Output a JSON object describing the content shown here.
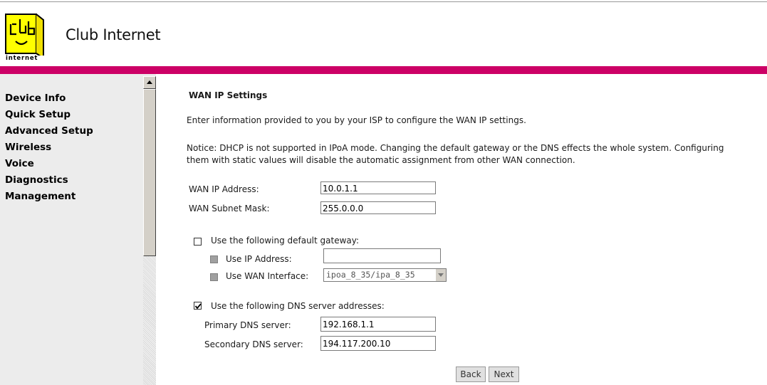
{
  "brand": {
    "title": "Club Internet",
    "logo_text": "internet",
    "logo_color": "#ffff00",
    "bar_color": "#cc0066"
  },
  "sidebar": {
    "items": [
      {
        "label": "Device Info"
      },
      {
        "label": "Quick Setup"
      },
      {
        "label": "Advanced Setup"
      },
      {
        "label": "Wireless"
      },
      {
        "label": "Voice"
      },
      {
        "label": "Diagnostics"
      },
      {
        "label": "Management"
      }
    ]
  },
  "main": {
    "title": "WAN IP Settings",
    "intro": "Enter information provided to you by your ISP to configure the WAN IP settings.",
    "notice_line1": "Notice: DHCP is not supported in IPoA mode. Changing the default gateway or the DNS effects the whole system. Configuring",
    "notice_line2": "them with static values will disable the automatic assignment from other WAN connection.",
    "wan_ip": {
      "label": "WAN IP Address:",
      "value": "10.0.1.1"
    },
    "wan_mask": {
      "label": "WAN Subnet Mask:",
      "value": "255.0.0.0"
    },
    "gateway": {
      "label": "Use the following default gateway:",
      "checked": false,
      "use_ip_label": "Use IP Address:",
      "use_ip_value": "",
      "use_wan_label": "Use WAN Interface:",
      "use_wan_value": "ipoa_8_35/ipa_8_35"
    },
    "dns": {
      "label": "Use the following DNS server addresses:",
      "checked": true,
      "primary_label": "Primary DNS server:",
      "primary_value": "192.168.1.1",
      "secondary_label": "Secondary DNS server:",
      "secondary_value": "194.117.200.10"
    },
    "buttons": {
      "back": "Back",
      "next": "Next"
    }
  }
}
